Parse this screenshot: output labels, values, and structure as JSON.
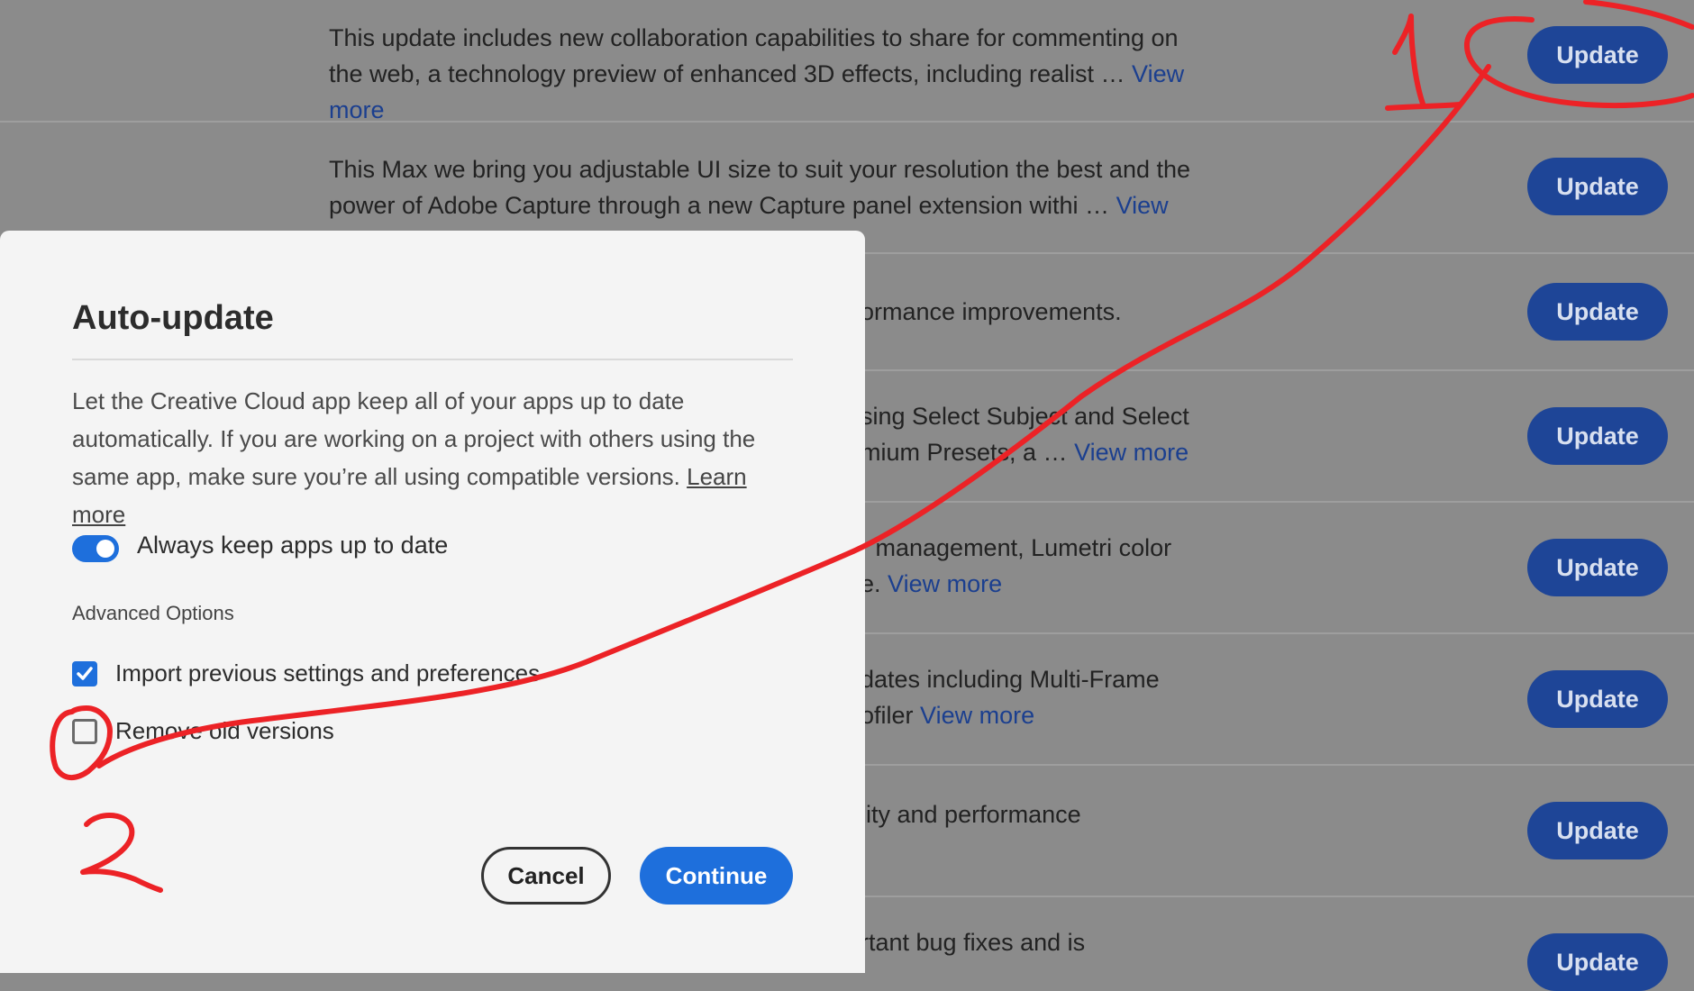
{
  "updates": [
    {
      "desc": "This update includes new collaboration capabilities to share for commenting on the web, a technology preview of enhanced 3D effects, including realist …",
      "view_more": "View more",
      "button": "Update"
    },
    {
      "desc": "This Max we bring you adjustable UI size to suit your resolution the best and the power of Adobe Capture through a new Capture panel extension withi …",
      "view_more": "View more",
      "button": "Update"
    },
    {
      "desc": "ormance improvements.",
      "view_more": "",
      "button": "Update"
    },
    {
      "desc": "sing Select Subject and Select\nmium Presets, a …",
      "view_more": "View more",
      "button": "Update"
    },
    {
      "desc": "r management, Lumetri color\ne.",
      "view_more": "View more",
      "button": "Update"
    },
    {
      "desc": "dates including Multi-Frame\nofiler",
      "view_more": "View more",
      "button": "Update"
    },
    {
      "desc": "lity and performance",
      "view_more": "",
      "button": "Update"
    },
    {
      "desc": "rtant bug fixes and is",
      "view_more": "",
      "button": "Update"
    }
  ],
  "modal": {
    "title": "Auto-update",
    "body": "Let the Creative Cloud app keep all of your apps up to date automatically. If you are working on a project with others using the same app, make sure you’re all using compatible versions.",
    "learn_more": "Learn more",
    "toggle_label": "Always keep apps up to date",
    "toggle_on": true,
    "advanced_heading": "Advanced Options",
    "import_label": "Import previous settings and preferences",
    "import_checked": true,
    "remove_label": "Remove old versions",
    "remove_checked": false,
    "cancel": "Cancel",
    "continue": "Continue"
  },
  "annotations": {
    "color": "#ec2226",
    "marks": [
      "1",
      "2"
    ]
  }
}
